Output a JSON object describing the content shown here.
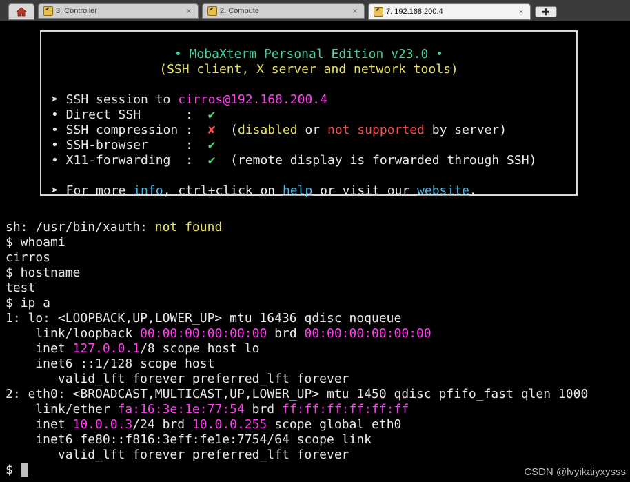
{
  "tabs": [
    {
      "label": "3. Controller"
    },
    {
      "label": "2. Compute"
    },
    {
      "label": "7. 192.168.200.4"
    }
  ],
  "tab_close": "×",
  "new_tab": "✚",
  "banner": {
    "title": "• MobaXterm Personal Edition v23.0 •",
    "subtitle": "(SSH client, X server and network tools)",
    "session_prefix": "➤ SSH session to ",
    "session_target": "cirros@192.168.200.4",
    "features": [
      {
        "label": "• Direct SSH      :  ",
        "mark": "✔"
      },
      {
        "label": "• SSH compression :  ",
        "mark": "✘",
        "note_open": "  (",
        "note_disabled": "disabled",
        "note_or": " or ",
        "note_notsup": "not supported",
        "note_rest": " by server)"
      },
      {
        "label": "• SSH-browser     :  ",
        "mark": "✔"
      },
      {
        "label": "• X11-forwarding  :  ",
        "mark": "✔",
        "note": "  (remote display is forwarded through SSH)"
      }
    ],
    "more_prefix": "➤ For more ",
    "more_info": "info",
    "more_mid": ", ctrl+click on ",
    "more_help": "help",
    "more_mid2": " or visit our ",
    "more_website": "website",
    "more_end": "."
  },
  "terminal": {
    "xauth_prefix": "sh: /usr/bin/xauth: ",
    "xauth_status": "not found",
    "cmd1": "$ whoami",
    "out1": "cirros",
    "cmd2": "$ hostname",
    "out2": "test",
    "cmd3": "$ ip a",
    "if1_head": "1: lo: <LOOPBACK,UP,LOWER_UP> mtu 16436 qdisc noqueue",
    "if1_link_pre": "    link/loopback ",
    "if1_mac": "00:00:00:00:00:00",
    "if1_link_mid": " brd ",
    "if1_brd": "00:00:00:00:00:00",
    "if1_inet_pre": "    inet ",
    "if1_inet_ip": "127.0.0.1",
    "if1_inet_rest": "/8 scope host lo",
    "if1_inet6": "    inet6 ::1/128 scope host",
    "if1_valid": "       valid_lft forever preferred_lft forever",
    "if2_head": "2: eth0: <BROADCAST,MULTICAST,UP,LOWER_UP> mtu 1450 qdisc pfifo_fast qlen 1000",
    "if2_link_pre": "    link/ether ",
    "if2_mac": "fa:16:3e:1e:77:54",
    "if2_link_mid": " brd ",
    "if2_brd": "ff:ff:ff:ff:ff:ff",
    "if2_inet_pre": "    inet ",
    "if2_inet_ip": "10.0.0.3",
    "if2_inet_mid": "/24 brd ",
    "if2_inet_brd": "10.0.0.255",
    "if2_inet_rest": " scope global eth0",
    "if2_inet6": "    inet6 fe80::f816:3eff:fe1e:7754/64 scope link",
    "if2_valid": "       valid_lft forever preferred_lft forever",
    "prompt": "$ "
  },
  "watermark": "CSDN @lvyikaiyxysss",
  "colors": {
    "title_green": "#45d19a",
    "magenta": "#ff3ff0",
    "yellow": "#e8e060",
    "red": "#ff4b4b",
    "link_blue": "#49b8e8"
  }
}
